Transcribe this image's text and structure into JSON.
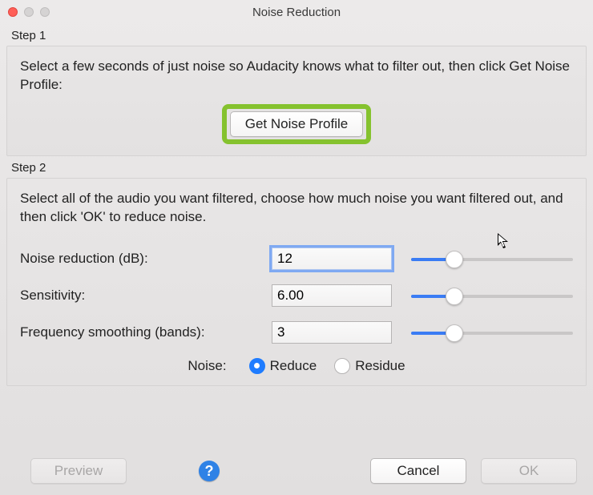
{
  "window": {
    "title": "Noise Reduction"
  },
  "step1": {
    "label": "Step 1",
    "instructions": "Select a few seconds of just noise so Audacity knows what to filter out, then click Get Noise Profile:",
    "button": "Get Noise Profile"
  },
  "step2": {
    "label": "Step 2",
    "instructions": "Select all of the audio you want filtered, choose how much noise you want filtered out, and then click 'OK' to reduce noise.",
    "fields": {
      "noise_reduction": {
        "label": "Noise reduction (dB):",
        "value": "12",
        "slider_pct": 26
      },
      "sensitivity": {
        "label": "Sensitivity:",
        "value": "6.00",
        "slider_pct": 26
      },
      "freq_smoothing": {
        "label": "Frequency smoothing (bands):",
        "value": "3",
        "slider_pct": 26
      }
    },
    "noise_label": "Noise:",
    "radios": {
      "reduce": "Reduce",
      "residue": "Residue",
      "selected": "reduce"
    }
  },
  "footer": {
    "preview": "Preview",
    "cancel": "Cancel",
    "ok": "OK"
  }
}
